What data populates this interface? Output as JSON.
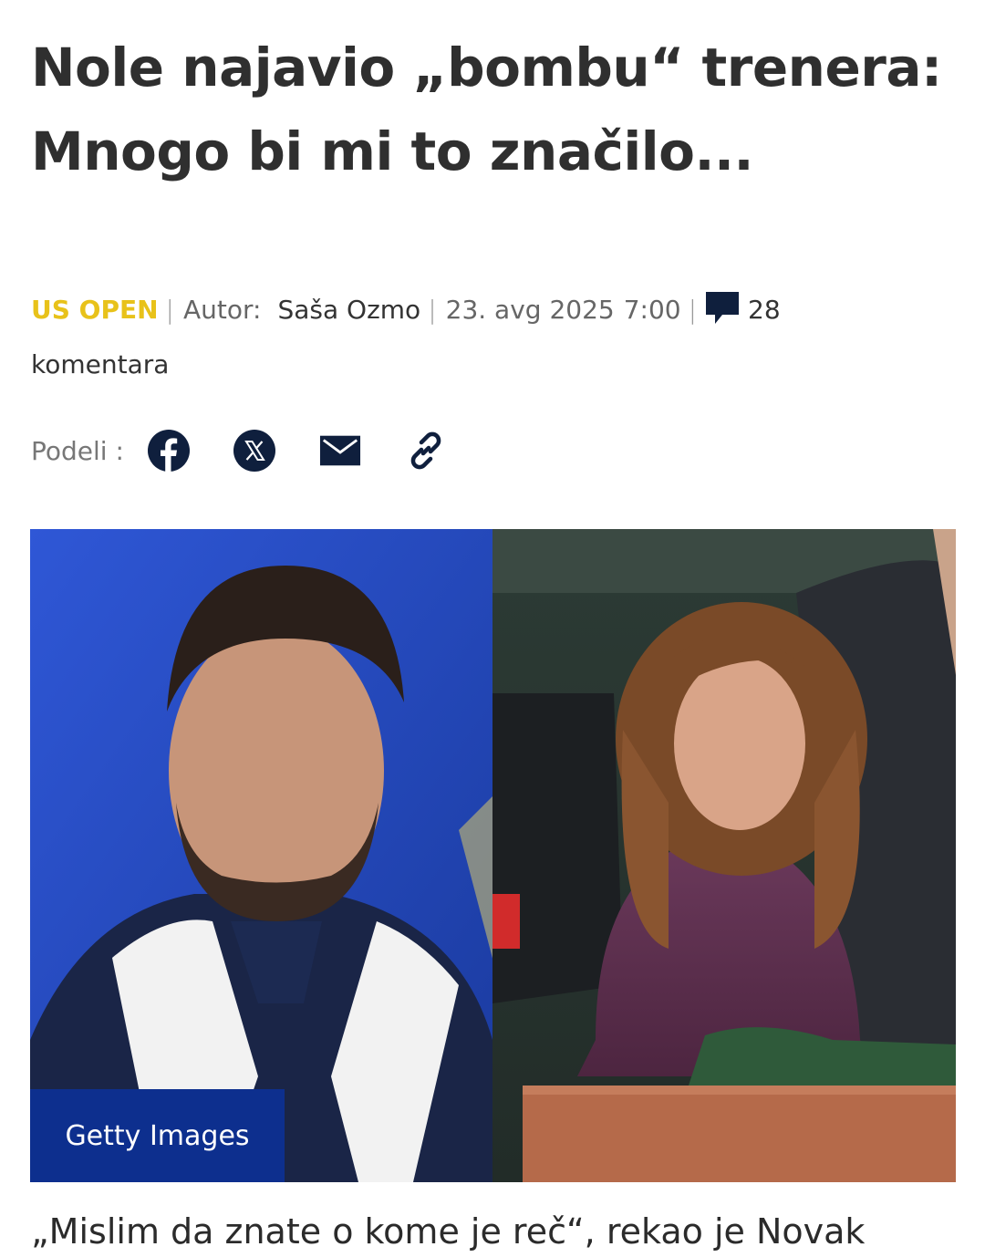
{
  "article": {
    "title": "Nole najavio „bombu“ trenera: Mnogo bi mi to značilo...",
    "category": "US OPEN",
    "author_label": "Autor:",
    "author": "Saša Ozmo",
    "date": "23. avg 2025",
    "time": "7:00",
    "comment_count": "28",
    "comments_label": "komentara",
    "image_credit": "Getty Images",
    "lead": "„Mislim da znate o kome je reč“, rekao je Novak"
  },
  "share": {
    "label": "Podeli :",
    "icons": [
      "facebook-icon",
      "x-icon",
      "mail-icon",
      "link-icon"
    ]
  },
  "colors": {
    "category": "#e8c21a",
    "icon": "#0f1f3d",
    "credit_bg": "#0d2f8e"
  }
}
